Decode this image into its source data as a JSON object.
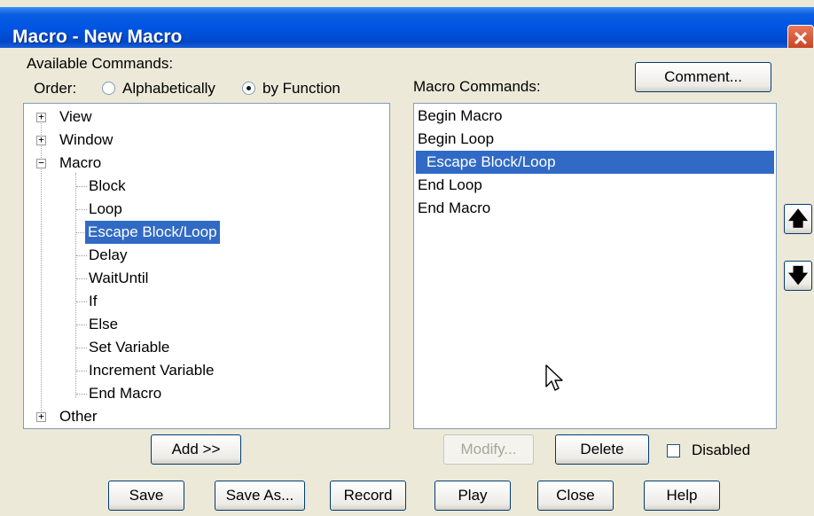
{
  "window": {
    "title": "Macro - New Macro",
    "close_glyph": "✕"
  },
  "available": {
    "label": "Available Commands:",
    "order_label": "Order:",
    "order_options": [
      "Alphabetically",
      "by Function"
    ],
    "order_selected": "by Function",
    "tree": [
      {
        "label": "View",
        "expander": "+"
      },
      {
        "label": "Window",
        "expander": "+"
      },
      {
        "label": "Macro",
        "expander": "−"
      },
      {
        "label": "Block"
      },
      {
        "label": "Loop"
      },
      {
        "label": "Escape Block/Loop",
        "selected": true
      },
      {
        "label": "Delay"
      },
      {
        "label": "WaitUntil"
      },
      {
        "label": "If"
      },
      {
        "label": "Else"
      },
      {
        "label": "Set Variable"
      },
      {
        "label": "Increment Variable"
      },
      {
        "label": "End Macro"
      },
      {
        "label": "Other",
        "expander": "+"
      }
    ],
    "scroll_up_glyph": "▲",
    "scroll_down_glyph": "▼",
    "thumb_grip": "≡"
  },
  "macro_commands": {
    "label": "Macro Commands:",
    "items": [
      "Begin Macro",
      "Begin Loop",
      "Escape Block/Loop",
      "End Loop",
      "End Macro"
    ],
    "selected_index": 2
  },
  "buttons": {
    "comment": "Comment...",
    "add": "Add >>",
    "modify": "Modify...",
    "delete": "Delete",
    "disabled_label": "Disabled",
    "save": "Save",
    "save_as": "Save As...",
    "record": "Record",
    "play": "Play",
    "close": "Close",
    "help": "Help",
    "move_up_glyph": "🡅",
    "move_down_glyph": "🡇"
  },
  "colors": {
    "titlebar": "#0054e3",
    "selection": "#316ac5",
    "dialog_bg": "#ece9d8"
  },
  "cursor": "mouse-pointer-icon"
}
